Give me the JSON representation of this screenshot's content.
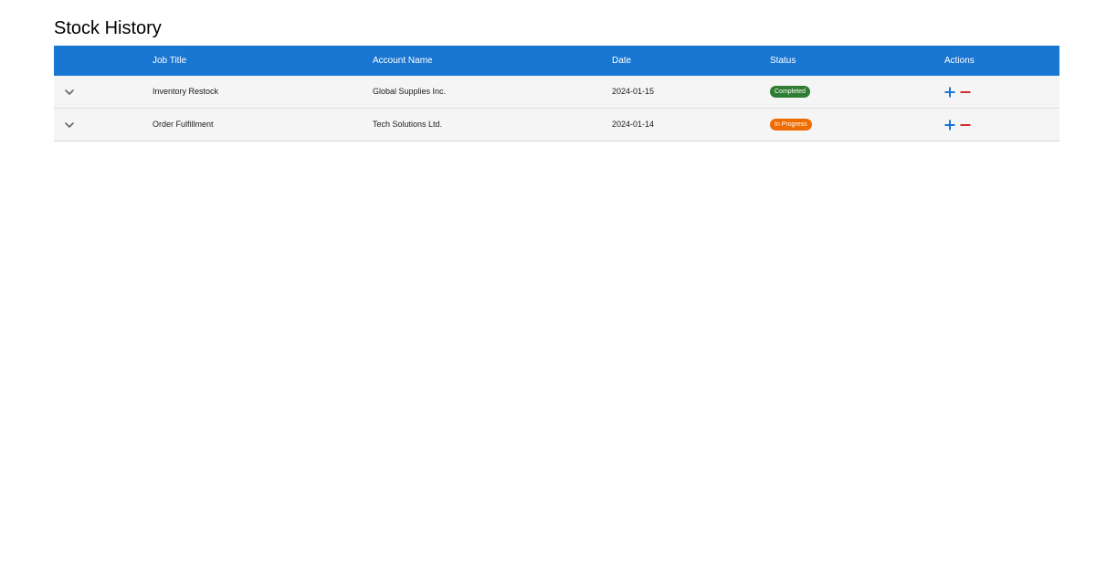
{
  "page": {
    "title": "Stock History"
  },
  "table": {
    "columns": {
      "job_title": "Job Title",
      "account_name": "Account Name",
      "date": "Date",
      "status": "Status",
      "actions": "Actions"
    },
    "rows": [
      {
        "job_title": "Inventory Restock",
        "account_name": "Global Supplies Inc.",
        "date": "2024-01-15",
        "status": "Completed",
        "status_color": "#2e7d32"
      },
      {
        "job_title": "Order Fulfillment",
        "account_name": "Tech Solutions Ltd.",
        "date": "2024-01-14",
        "status": "In Progress",
        "status_color": "#ef6c00"
      }
    ]
  },
  "icons": {
    "expand": "chevron-down-icon",
    "add": "plus-icon",
    "remove": "minus-icon"
  },
  "colors": {
    "header_bg": "#1976d2",
    "row_bg": "#f5f5f5",
    "add_icon": "#1976d2",
    "remove_icon": "#d32f2f"
  }
}
